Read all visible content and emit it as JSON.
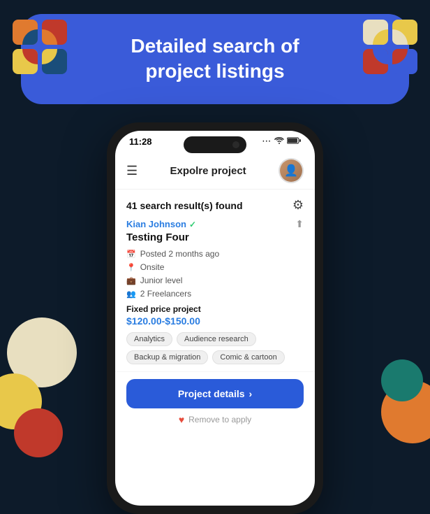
{
  "header": {
    "title_line1": "Detailed search of",
    "title_line2": "project listings",
    "background_color": "#3a5bd9"
  },
  "status_bar": {
    "time": "11:28",
    "dots": "···",
    "wifi": "WiFi",
    "battery": "Battery"
  },
  "app": {
    "title": "Expolre project",
    "results_count": "41 search result(s) found"
  },
  "project": {
    "user_name": "Kian Johnson",
    "verified": true,
    "title": "Testing Four",
    "posted": "Posted 2 months ago",
    "location": "Onsite",
    "level": "Junior level",
    "freelancers": "2 Freelancers",
    "price_label": "Fixed price project",
    "price_value": "$120.00-$150.00",
    "tags": [
      "Analytics",
      "Audience research",
      "Backup & migration",
      "Comic & cartoon"
    ]
  },
  "buttons": {
    "project_details": "Project details",
    "remove_label": "Remove to apply"
  }
}
